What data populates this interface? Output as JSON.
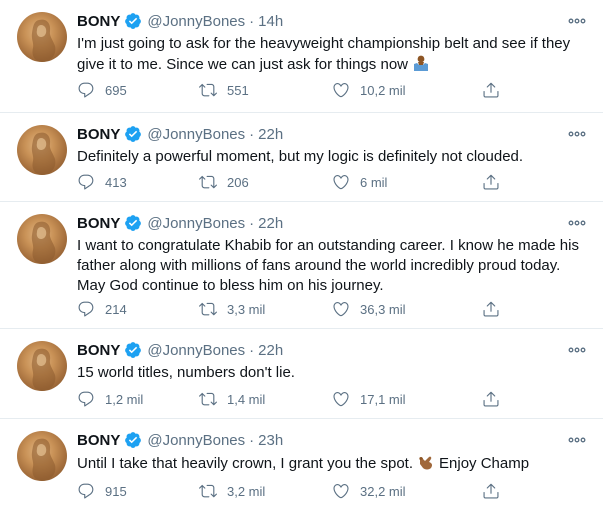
{
  "tweets": [
    {
      "name": "BONY",
      "handle": "@JonnyBones",
      "time": "14h",
      "text": "I'm just going to ask for the heavyweight championship belt and see if they give it to me. Since we can just ask for things now",
      "emoji": "person-shrugging-emoji",
      "replies": "695",
      "retweets": "551",
      "likes": "10,2 mil"
    },
    {
      "name": "BONY",
      "handle": "@JonnyBones",
      "time": "22h",
      "text": "Definitely a powerful moment, but my logic is definitely not clouded.",
      "replies": "413",
      "retweets": "206",
      "likes": "6 mil"
    },
    {
      "name": "BONY",
      "handle": "@JonnyBones",
      "time": "22h",
      "text": "I want to congratulate Khabib for an outstanding career. I know he made his father along with millions of fans around the world incredibly proud today. May God continue to bless him on his journey.",
      "replies": "214",
      "retweets": "3,3 mil",
      "likes": "36,3 mil"
    },
    {
      "name": "BONY",
      "handle": "@JonnyBones",
      "time": "22h",
      "text": "15 world titles, numbers don't lie.",
      "replies": "1,2 mil",
      "retweets": "1,4 mil",
      "likes": "17,1 mil"
    },
    {
      "name": "BONY",
      "handle": "@JonnyBones",
      "time": "23h",
      "text_before": "Until I take that heavily crown, I grant you the spot.",
      "text_after": "Enjoy Champ",
      "emoji": "call-me-hand-emoji",
      "replies": "915",
      "retweets": "3,2 mil",
      "likes": "32,2 mil"
    }
  ],
  "colors": {
    "text": "#0f1419",
    "muted": "#5b7083",
    "verified": "#1da1f2",
    "divider": "#e6ecf0"
  },
  "icons": [
    "verified-badge-icon",
    "more-options-icon",
    "reply-icon",
    "retweet-icon",
    "like-icon",
    "share-icon"
  ]
}
